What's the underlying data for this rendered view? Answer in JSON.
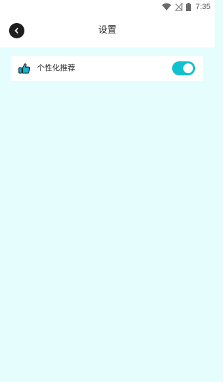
{
  "status_bar": {
    "time": "7:35",
    "icons": [
      "wifi-icon",
      "signal-no-sim-icon",
      "battery-icon"
    ]
  },
  "app_bar": {
    "title": "设置",
    "back_icon": "chevron-left-icon"
  },
  "settings": [
    {
      "icon": "thumbs-up-icon",
      "label": "个性化推荐",
      "toggle_on": true
    }
  ],
  "colors": {
    "page_background": "#e6fdfd",
    "toggle_on": "#10c2cf",
    "back_button": "#1e1e1e",
    "icon_accent": "#19b3d6"
  }
}
